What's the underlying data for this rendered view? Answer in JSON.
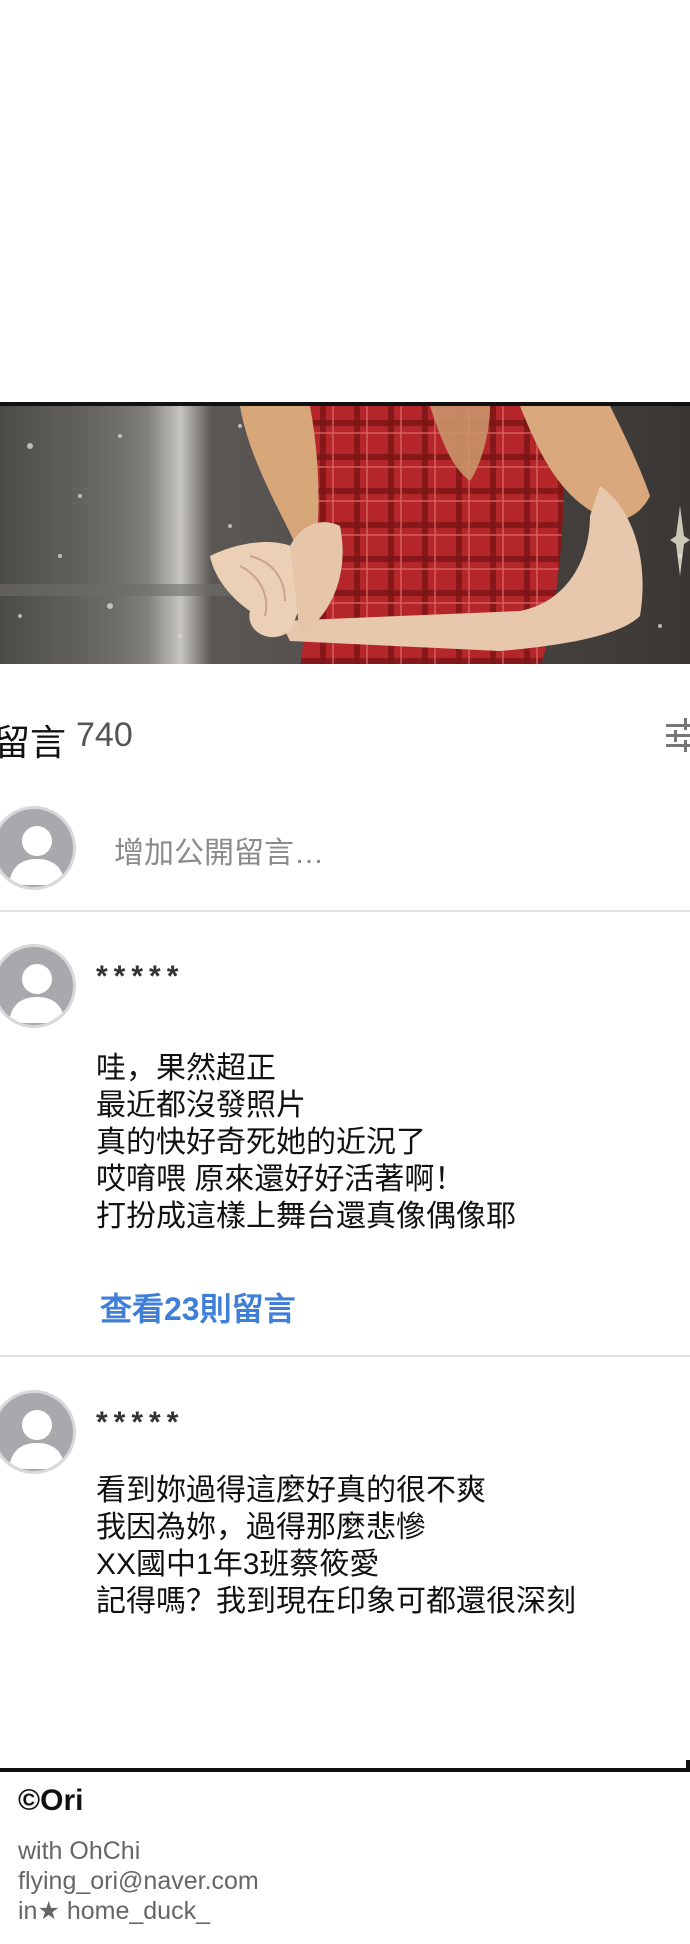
{
  "comments_section": {
    "title": "留言",
    "count": "740",
    "sort_icon": "sort-icon",
    "add_comment": {
      "avatar_icon": "default-avatar-icon",
      "placeholder": "增加公開留言…"
    },
    "items": [
      {
        "author": "*****",
        "body": [
          "哇，果然超正",
          "最近都沒發照片",
          "真的快好奇死她的近況了",
          "哎唷喂 原來還好好活著啊！",
          "打扮成這樣上舞台還真像偶像耶"
        ],
        "replies_label": "查看23則留言"
      },
      {
        "author": "*****",
        "body": [
          "看到妳過得這麼好真的很不爽",
          "我因為妳，過得那麼悲慘",
          "XX國中1年3班蔡筱愛",
          "記得嗎？我到現在印象可都還很深刻"
        ]
      }
    ]
  },
  "credits": {
    "copyright": "©Ori",
    "with": "with OhChi",
    "email": "flying_ori@naver.com",
    "instagram": "in★ home_duck_"
  },
  "colors": {
    "link": "#3f7fd8",
    "avatar": "#a9a9ad",
    "dress": "#b8292b"
  }
}
